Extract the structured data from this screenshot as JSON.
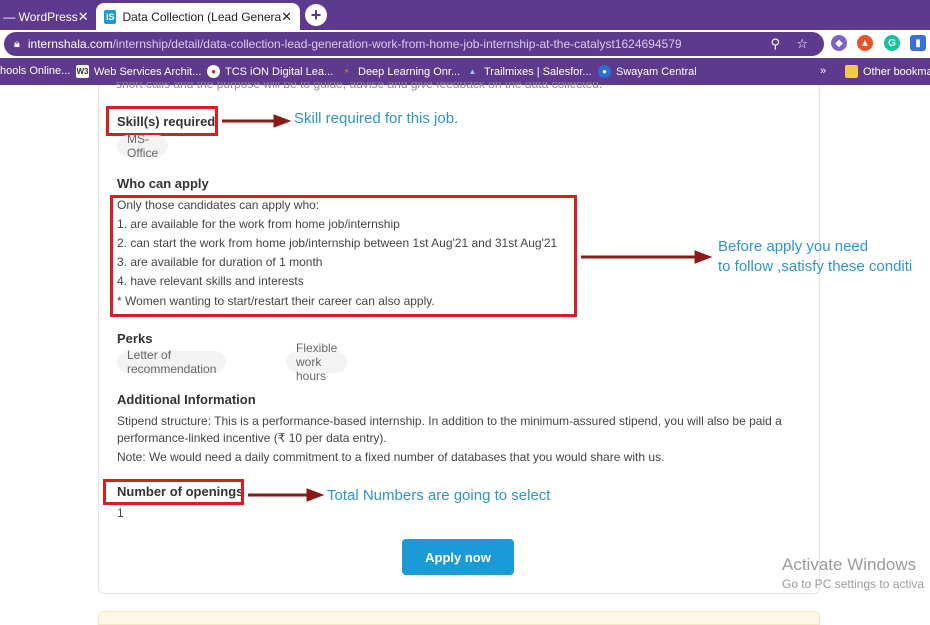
{
  "browser": {
    "tabs": [
      {
        "label": "c — WordPress",
        "active": false
      },
      {
        "label": "Data Collection (Lead Generation",
        "active": true,
        "favicon": "IS"
      }
    ],
    "new_tab_symbol": "+",
    "url_host": "internshala.com",
    "url_path": "/internship/detail/data-collection-lead-generation-work-from-home-job-internship-at-the-catalyst1624694579",
    "bookmarks": [
      {
        "label": "hools Online...",
        "icon": ""
      },
      {
        "label": "Web Services Archit...",
        "icon": "W3"
      },
      {
        "label": "TCS iON Digital Lea...",
        "icon": ""
      },
      {
        "label": "Deep Learning Onr...",
        "icon": ""
      },
      {
        "label": "Trailmixes | Salesfor...",
        "icon": ""
      },
      {
        "label": "Swayam Central",
        "icon": ""
      }
    ],
    "bookmarks_overflow": "»",
    "other_bookmarks": "Other bookma",
    "extensions": [
      "G"
    ]
  },
  "content": {
    "cut_text": "short calls and the purpose will be to guide, advise and give feedback on the data collected.",
    "skills_heading": "Skill(s) required",
    "skills": [
      "MS-Office"
    ],
    "who_heading": "Who can apply",
    "who_lines": [
      "Only those candidates can apply who:",
      "1. are available for the work from home job/internship",
      "2. can start the work from home job/internship between 1st Aug'21 and 31st Aug'21",
      "3. are available for duration of 1 month",
      "4. have relevant skills and interests",
      "* Women wanting to start/restart their career can also apply."
    ],
    "perks_heading": "Perks",
    "perks": [
      "Letter of recommendation",
      "Flexible work hours"
    ],
    "additional_heading": "Additional Information",
    "additional_line1": "Stipend structure: This is a performance-based internship. In addition to the minimum-assured stipend, you will also be paid a",
    "additional_line2": "performance-linked incentive (₹ 10 per data entry).",
    "additional_line3": "Note: We would need a daily commitment to a fixed number of databases that you would share with us.",
    "openings_heading": "Number of openings",
    "openings_value": "1",
    "apply_label": "Apply now"
  },
  "annotations": {
    "skill_note": "Skill required for this job.",
    "condition_note_1": "Before apply you need",
    "condition_note_2": "to follow ,satisfy these conditi",
    "openings_note": "Total Numbers are going to select",
    "color_red": "#d81e1e",
    "color_arrow": "#8b1a1a",
    "color_text": "#2b95cf"
  },
  "watermark": {
    "title": "Activate Windows",
    "subtitle": "Go to PC settings to activa"
  }
}
